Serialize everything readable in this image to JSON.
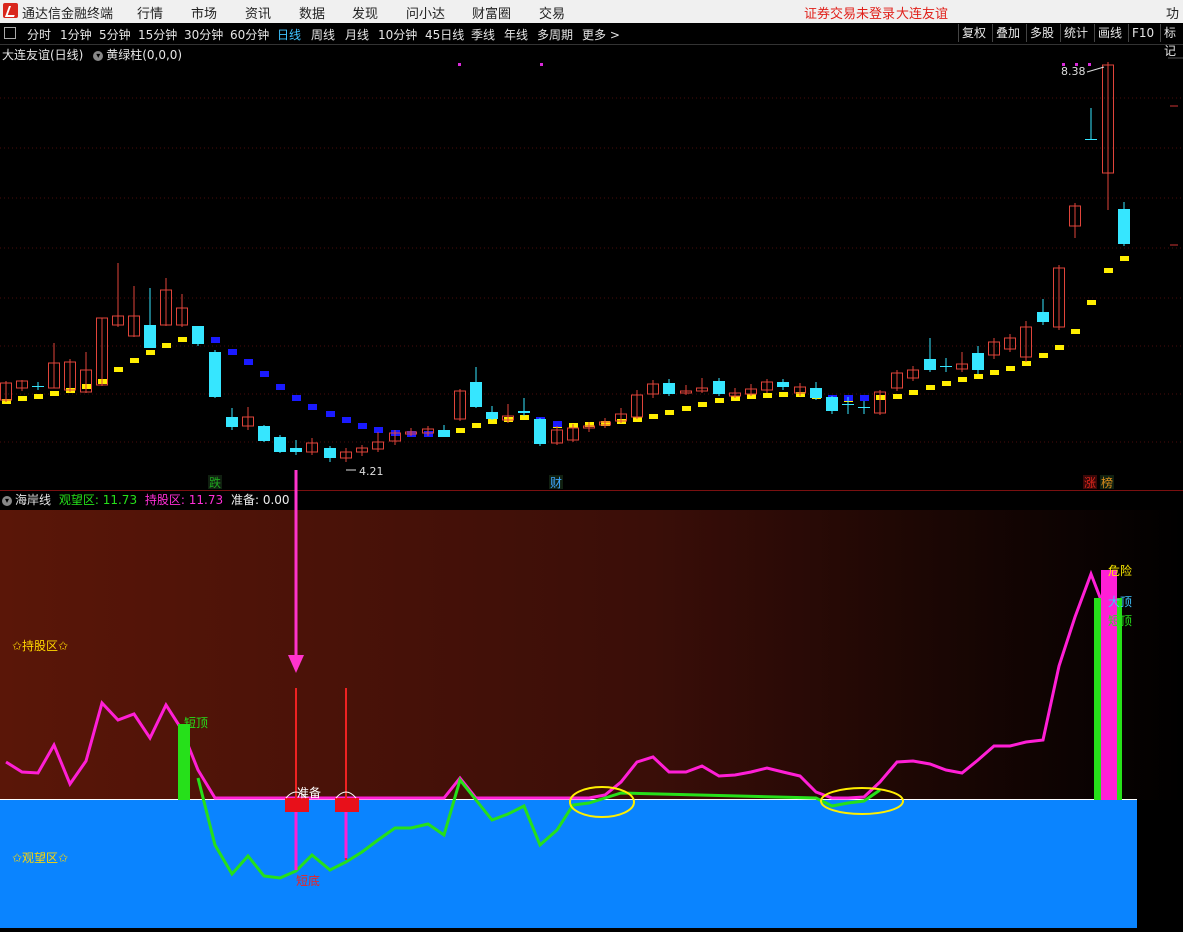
{
  "menubar": {
    "app_name": "通达信金融终端",
    "items": [
      "行情",
      "市场",
      "资讯",
      "数据",
      "发现",
      "问小达",
      "财富圈",
      "交易"
    ],
    "login_status": "证券交易未登录",
    "stock_link": "大连友谊",
    "right_edge": "功"
  },
  "toolbar": {
    "periods": [
      "分时",
      "1分钟",
      "5分钟",
      "15分钟",
      "30分钟",
      "60分钟",
      "日线",
      "周线",
      "月线",
      "10分钟",
      "45日线",
      "季线",
      "年线",
      "多周期",
      "更多 >"
    ],
    "active_period": "日线",
    "right_buttons": [
      "复权",
      "叠加",
      "多股",
      "统计",
      "画线",
      "F10",
      "标记"
    ]
  },
  "main_chart": {
    "stock_title": "大连友谊(日线)",
    "indicator": "黄绿柱(0,0,0)",
    "high_label": "8.38",
    "low_label": "4.21",
    "markers": [
      {
        "text": "跌",
        "color": "#1fa51f"
      },
      {
        "text": "财",
        "color": "#3fa6ff"
      },
      {
        "text": "涨",
        "color": "#d9261c"
      },
      {
        "text": "榜",
        "color": "#d98c1c"
      }
    ],
    "colors": {
      "up": "#e0443a",
      "down": "#36e6ff",
      "yellow": "#ffee00",
      "blue": "#1a1aff"
    }
  },
  "sub_chart": {
    "name": "海岸线",
    "watch_label": "观望区:",
    "watch_value": "11.73",
    "hold_label": "持股区:",
    "hold_value": "11.73",
    "prep_label": "准备:",
    "prep_value": "0.00",
    "zone_hold": "✩持股区✩",
    "zone_watch": "✩观望区✩",
    "short_top": "短顶",
    "prepare": "准备",
    "short_bottom": "短底",
    "danger": "危险",
    "big_top": "大顶",
    "colors": {
      "magenta": "#ff1fd6",
      "green": "#26e01a",
      "blue": "#0a84ff",
      "arrow": "#ff33cc"
    }
  }
}
